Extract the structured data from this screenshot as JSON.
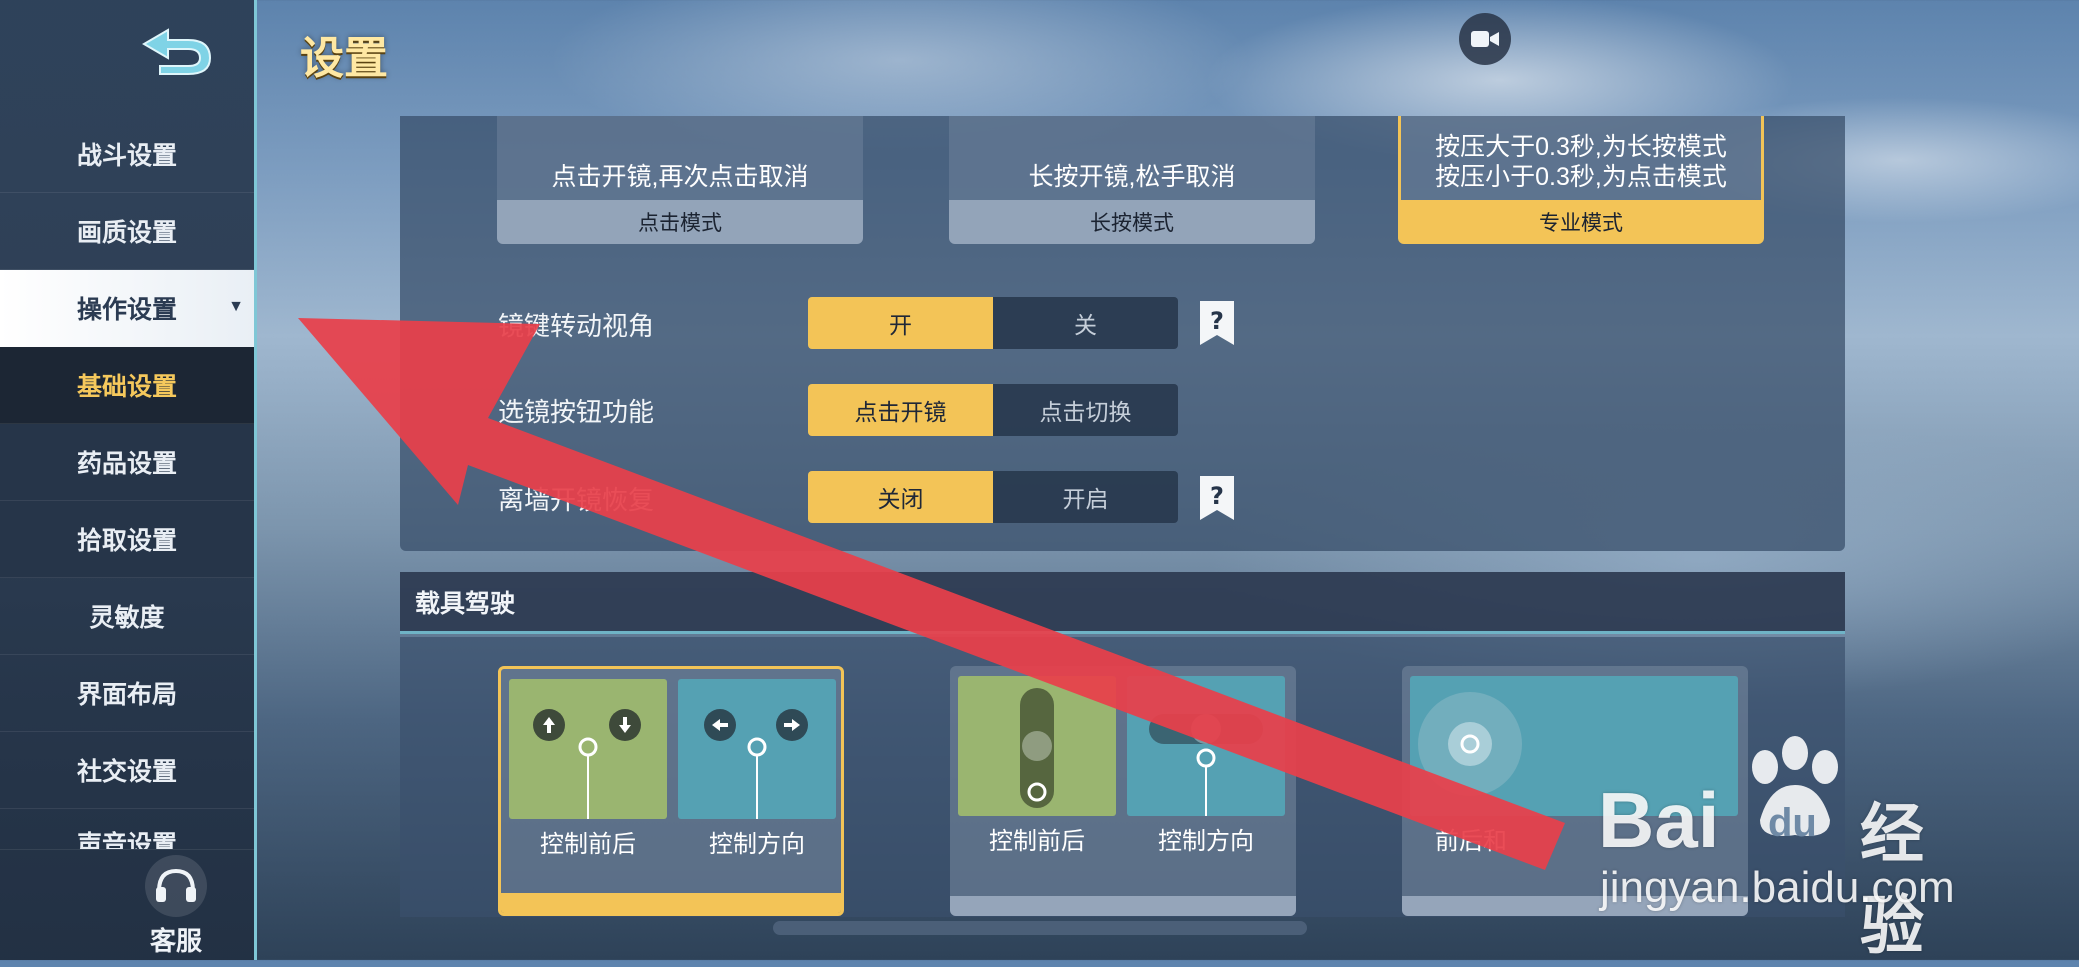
{
  "header": {
    "title": "设置"
  },
  "sidebar": {
    "items": [
      {
        "label": "战斗设置"
      },
      {
        "label": "画质设置"
      },
      {
        "label": "操作设置"
      },
      {
        "label": "基础设置"
      },
      {
        "label": "药品设置"
      },
      {
        "label": "拾取设置"
      },
      {
        "label": "灵敏度"
      },
      {
        "label": "界面布局"
      },
      {
        "label": "社交设置"
      },
      {
        "label": "声音设置"
      }
    ],
    "support_label": "客服"
  },
  "scope_modes": [
    {
      "desc_lines": [
        "点击开镜,再次点击取消"
      ],
      "label": "点击模式"
    },
    {
      "desc_lines": [
        "长按开镜,松手取消"
      ],
      "label": "长按模式"
    },
    {
      "desc_lines": [
        "按压大于0.3秒,为长按模式",
        "按压小于0.3秒,为点击模式"
      ],
      "label": "专业模式"
    }
  ],
  "settings_rows": [
    {
      "label": "镜键转动视角",
      "options": [
        "开",
        "关"
      ],
      "selected": 0,
      "has_help": true
    },
    {
      "label": "选镜按钮功能",
      "options": [
        "点击开镜",
        "点击切换"
      ],
      "selected": 0,
      "has_help": false
    },
    {
      "label": "离墙开镜恢复",
      "options": [
        "关闭",
        "开启"
      ],
      "selected": 0,
      "has_help": true
    }
  ],
  "vehicle": {
    "section_title": "载具驾驶",
    "cards": [
      {
        "captions": [
          "控制前后",
          "控制方向"
        ]
      },
      {
        "captions": [
          "控制前后",
          "控制方向"
        ]
      },
      {
        "captions": [
          "前后和"
        ]
      }
    ]
  },
  "watermark": {
    "brand": "Bai",
    "brand2": "du",
    "suffix": "经验",
    "url": "jingyan.baidu.com"
  },
  "colors": {
    "accent": "#f3c457",
    "sidebar": "#2b3d54",
    "arrow": "#e8404a"
  }
}
